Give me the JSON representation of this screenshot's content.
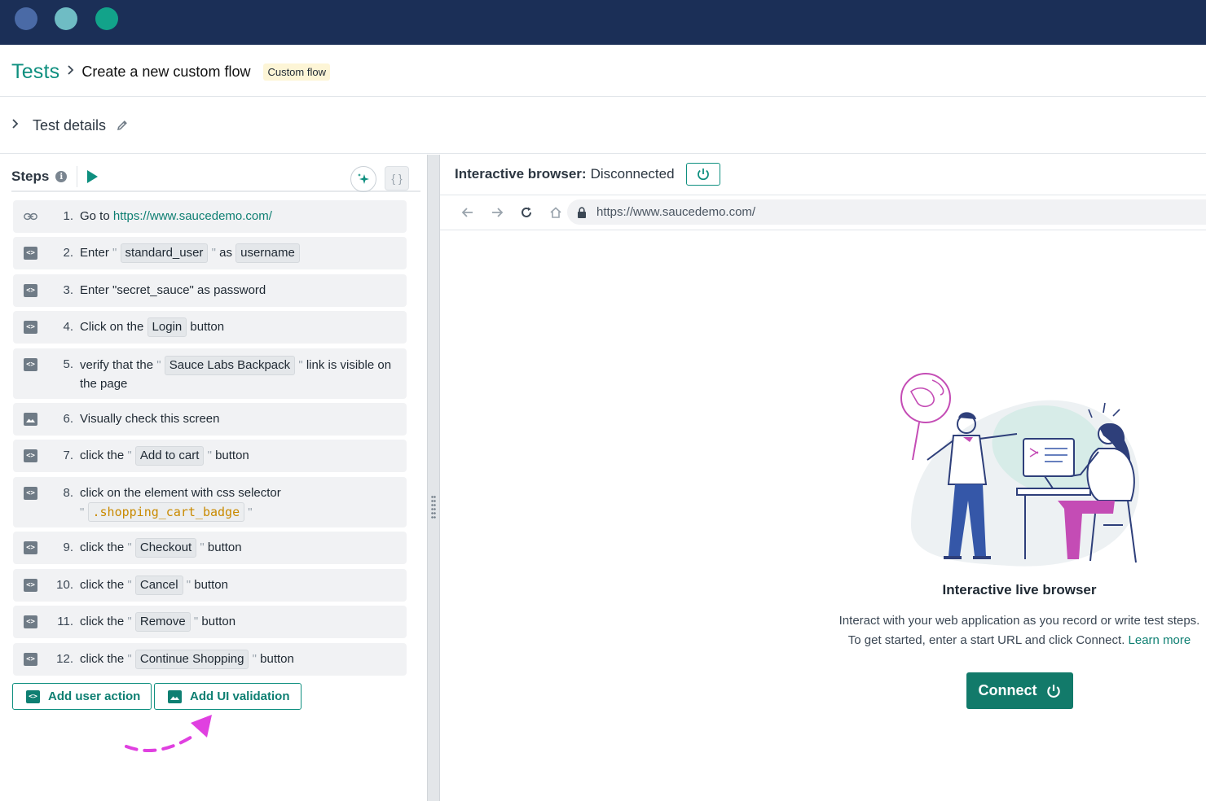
{
  "breadcrumb": {
    "root": "Tests",
    "title": "Create a new custom flow",
    "badge": "Custom flow"
  },
  "details": {
    "label": "Test details"
  },
  "steps_panel": {
    "title": "Steps",
    "code_toggle": "{ }"
  },
  "steps": [
    {
      "num": "1.",
      "type": "link",
      "prefix": "Go to ",
      "url": "https://www.saucedemo.com/"
    },
    {
      "num": "2.",
      "type": "code",
      "prefix": "Enter ",
      "chip1": "standard_user",
      "mid": " as ",
      "chip2": "username"
    },
    {
      "num": "3.",
      "type": "code",
      "text": "Enter \"secret_sauce\" as password"
    },
    {
      "num": "4.",
      "type": "code",
      "prefix": "Click on the ",
      "chip": "Login",
      "suffix": " button"
    },
    {
      "num": "5.",
      "type": "code",
      "prefix": "verify that the ",
      "chip": "Sauce Labs Backpack",
      "suffix": " link is visible on the page"
    },
    {
      "num": "6.",
      "type": "image",
      "text": "Visually check this screen"
    },
    {
      "num": "7.",
      "type": "code",
      "prefix": "click the ",
      "chip": "Add to cart",
      "suffix": " button"
    },
    {
      "num": "8.",
      "type": "code",
      "prefix": "click on the element with css selector",
      "code": ".shopping_cart_badge"
    },
    {
      "num": "9.",
      "type": "code",
      "prefix": "click the ",
      "chip": "Checkout",
      "suffix": " button"
    },
    {
      "num": "10.",
      "type": "code",
      "prefix": "click the ",
      "chip": "Cancel",
      "suffix": " button"
    },
    {
      "num": "11.",
      "type": "code",
      "prefix": "click the ",
      "chip": "Remove",
      "suffix": " button"
    },
    {
      "num": "12.",
      "type": "code",
      "prefix": "click the ",
      "chip": "Continue Shopping",
      "suffix": " button"
    }
  ],
  "actions": {
    "add_user_action": "Add user action",
    "add_ui_validation": "Add UI validation"
  },
  "browser": {
    "label": "Interactive browser:",
    "status": "Disconnected",
    "url": "https://www.saucedemo.com/",
    "empty_title": "Interactive live browser",
    "empty_line1": "Interact with your web application as you record or write test steps.",
    "empty_line2": "To get started, enter a start URL and click Connect.",
    "learn_more": "Learn more",
    "connect_label": "Connect"
  },
  "colors": {
    "brand": "#0e8f7f",
    "titlebar": "#1b2f57",
    "annotation": "#e040e0"
  },
  "icons": [
    "info-icon",
    "play-icon",
    "sparkle-icon",
    "code-icon",
    "link-icon",
    "image-icon",
    "pencil-icon",
    "power-icon",
    "back-icon",
    "forward-icon",
    "reload-icon",
    "home-icon",
    "lock-icon"
  ]
}
